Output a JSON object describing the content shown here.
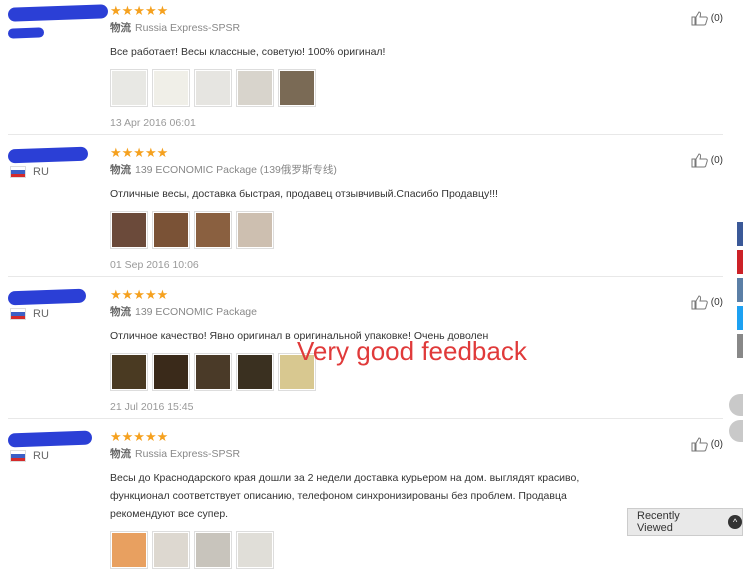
{
  "reviews": [
    {
      "country": "",
      "stars": "★★★★★",
      "shipping_label": "物流",
      "shipping_method": "Russia Express-SPSR",
      "text": "Все работает! Весы классные, советую! 100% оригинал!",
      "date": "13 Apr 2016 06:01",
      "helpful_count": "(0)",
      "photo_colors": [
        "#e8e8e4",
        "#f0efe8",
        "#e6e5e1",
        "#d8d4cc",
        "#7a6a55"
      ]
    },
    {
      "country": "RU",
      "stars": "★★★★★",
      "shipping_label": "物流",
      "shipping_method": "139 ECONOMIC Package (139俄罗斯专线)",
      "text": "Отличные весы, доставка быстрая, продавец отзывчивый.Спасибо Продавцу!!!",
      "date": "01 Sep 2016 10:06",
      "helpful_count": "(0)",
      "photo_colors": [
        "#6b4a3a",
        "#7a5236",
        "#8a6040",
        "#cdbfb0"
      ]
    },
    {
      "country": "RU",
      "stars": "★★★★★",
      "shipping_label": "物流",
      "shipping_method": "139 ECONOMIC Package",
      "text": "Отличное качество! Явно оригинал в оригинальной упаковке! Очень доволен",
      "date": "21 Jul 2016 15:45",
      "helpful_count": "(0)",
      "photo_colors": [
        "#4a3a22",
        "#3a2a1a",
        "#4a3a28",
        "#3a3020",
        "#d8c890"
      ]
    },
    {
      "country": "RU",
      "stars": "★★★★★",
      "shipping_label": "物流",
      "shipping_method": "Russia Express-SPSR",
      "text": "Весы до Краснодарского края дошли за 2 недели доставка курьером на дом. выглядят красиво, функционал соответствует описанию, телефоном синхронизированы без проблем. Продавца рекомендуют все супер.",
      "date": "",
      "helpful_count": "(0)",
      "photo_colors": [
        "#e8a060",
        "#ddd8d0",
        "#c8c4bc",
        "#e0ded8"
      ]
    }
  ],
  "overlay_text": "Very good feedback",
  "recently_viewed": {
    "label": "Recently Viewed",
    "chevron": "^"
  },
  "colors": {
    "star": "#f5a11f",
    "overlay": "#e03a3a",
    "scribble": "#2b3fd6",
    "share": [
      "#3b5998",
      "#cc2127",
      "#5b7fa6",
      "#1da1f2",
      "#888888"
    ]
  }
}
